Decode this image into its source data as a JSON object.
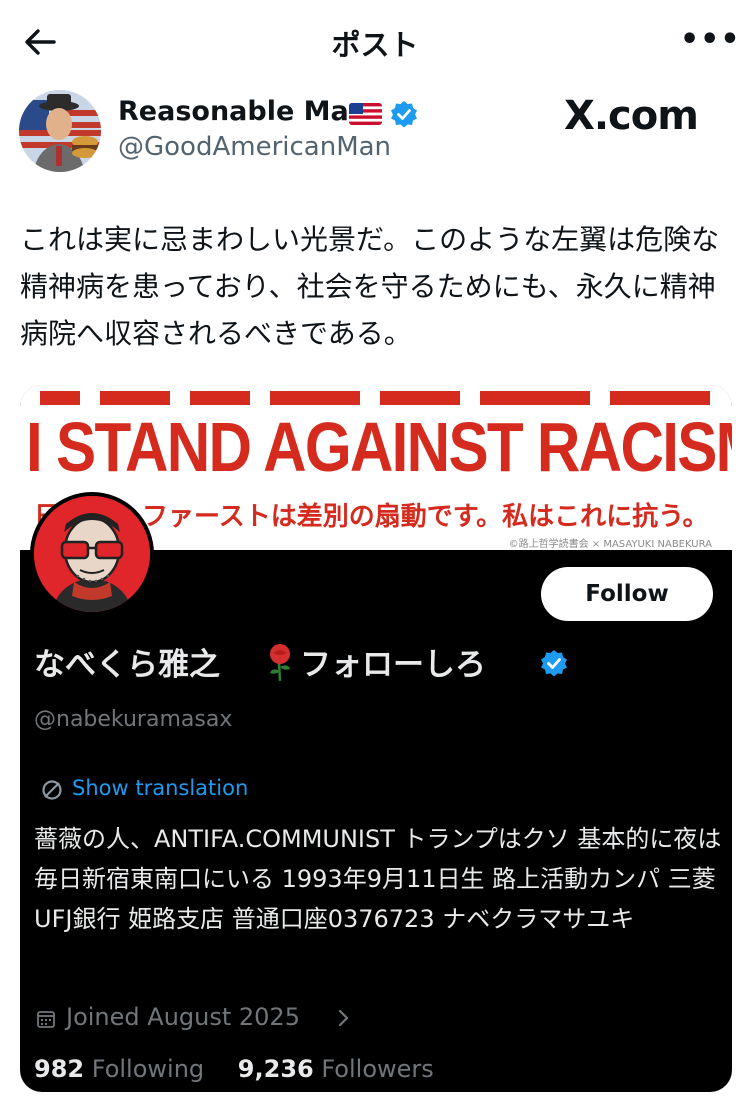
{
  "header": {
    "title": "ポスト",
    "more_label": "•••"
  },
  "author": {
    "name": "Reasonable Man",
    "handle": "@GoodAmericanMan",
    "verified": true,
    "flag": "us-flag"
  },
  "watermark": "X.com",
  "post": {
    "text": "これは実に忌まわしい光景だ。このような左翼は危険な精神病を患っており、社会を守るためにも、永久に精神病院へ収容されるべきである。"
  },
  "embed": {
    "banner": {
      "headline": "I STAND AGAINST RACISM",
      "subline_start": "日",
      "subline": "ファーストは差別の扇動です。私はこれに抗う。",
      "credit": "©路上哲学読書会 × MASAYUKI NABEKURA"
    },
    "follow_label": "Follow",
    "profile": {
      "name_part1": "なべくら雅之",
      "name_part2": "フォローしろ",
      "handle": "@nabekuramasax",
      "verified": true
    },
    "translate_label": "Show translation",
    "bio": "薔薇の人、ANTIFA.COMMUNIST トランプはクソ 基本的に夜は毎日新宿東南口にいる 1993年9月11日生 路上活動カンパ 三菱UFJ銀行 姫路支店 普通口座0376723 ナベクラマサユキ",
    "joined": "Joined August 2025",
    "following_count": "982",
    "following_label": "Following",
    "followers_count": "9,236",
    "followers_label": "Followers"
  },
  "colors": {
    "accent_blue": "#1d9bf0",
    "banner_red": "#d52b1e",
    "embed_bg": "#000000",
    "muted": "#536471"
  }
}
